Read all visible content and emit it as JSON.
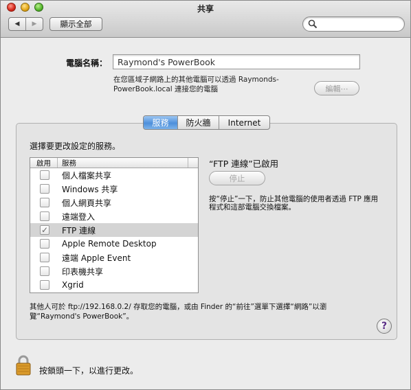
{
  "window": {
    "title": "共享"
  },
  "toolbar": {
    "back_glyph": "◀",
    "forward_glyph": "▶",
    "show_all_label": "顯示全部",
    "search_value": ""
  },
  "computer_name": {
    "label": "電腦名稱：",
    "value": "Raymond's PowerBook",
    "description": "在您區域子網路上的其他電腦可以透過 Raymonds-PowerBook.local 連接您的電腦",
    "edit_label": "編輯⋯"
  },
  "tabs": [
    {
      "label": "服務",
      "active": true
    },
    {
      "label": "防火牆",
      "active": false
    },
    {
      "label": "Internet",
      "active": false
    }
  ],
  "services": {
    "instruction": "選擇要更改設定的服務。",
    "columns": {
      "enabled": "啟用",
      "service": "服務"
    },
    "items": [
      {
        "name": "個人檔案共享",
        "checked": false,
        "selected": false
      },
      {
        "name": "Windows 共享",
        "checked": false,
        "selected": false
      },
      {
        "name": "個人網頁共享",
        "checked": false,
        "selected": false
      },
      {
        "name": "遠端登入",
        "checked": false,
        "selected": false
      },
      {
        "name": "FTP 連線",
        "checked": true,
        "selected": true
      },
      {
        "name": "Apple Remote Desktop",
        "checked": false,
        "selected": false
      },
      {
        "name": "遠端 Apple Event",
        "checked": false,
        "selected": false
      },
      {
        "name": "印表機共享",
        "checked": false,
        "selected": false
      },
      {
        "name": "Xgrid",
        "checked": false,
        "selected": false
      }
    ]
  },
  "status": {
    "title": "“FTP 連線”已啟用",
    "stop_label": "停止",
    "description": "按“停止”一下，防止其他電腦的使用者透過 FTP 應用程式和這部電腦交換檔案。"
  },
  "access_note": "其他人可於 ftp://192.168.0.2/ 存取您的電腦，或由 Finder 的“前往”選單下選擇“網路”以瀏覽“Raymond's PowerBook”。",
  "help_glyph": "?",
  "lock_text": "按鎖頭一下，以進行更改。",
  "icons": {
    "lock": "lock-icon",
    "search": "search-icon",
    "help": "help-icon"
  },
  "colors": {
    "tab_active": "#4d8fdb",
    "window_bg": "#ececec",
    "panel_bg": "#e4e4e4"
  }
}
